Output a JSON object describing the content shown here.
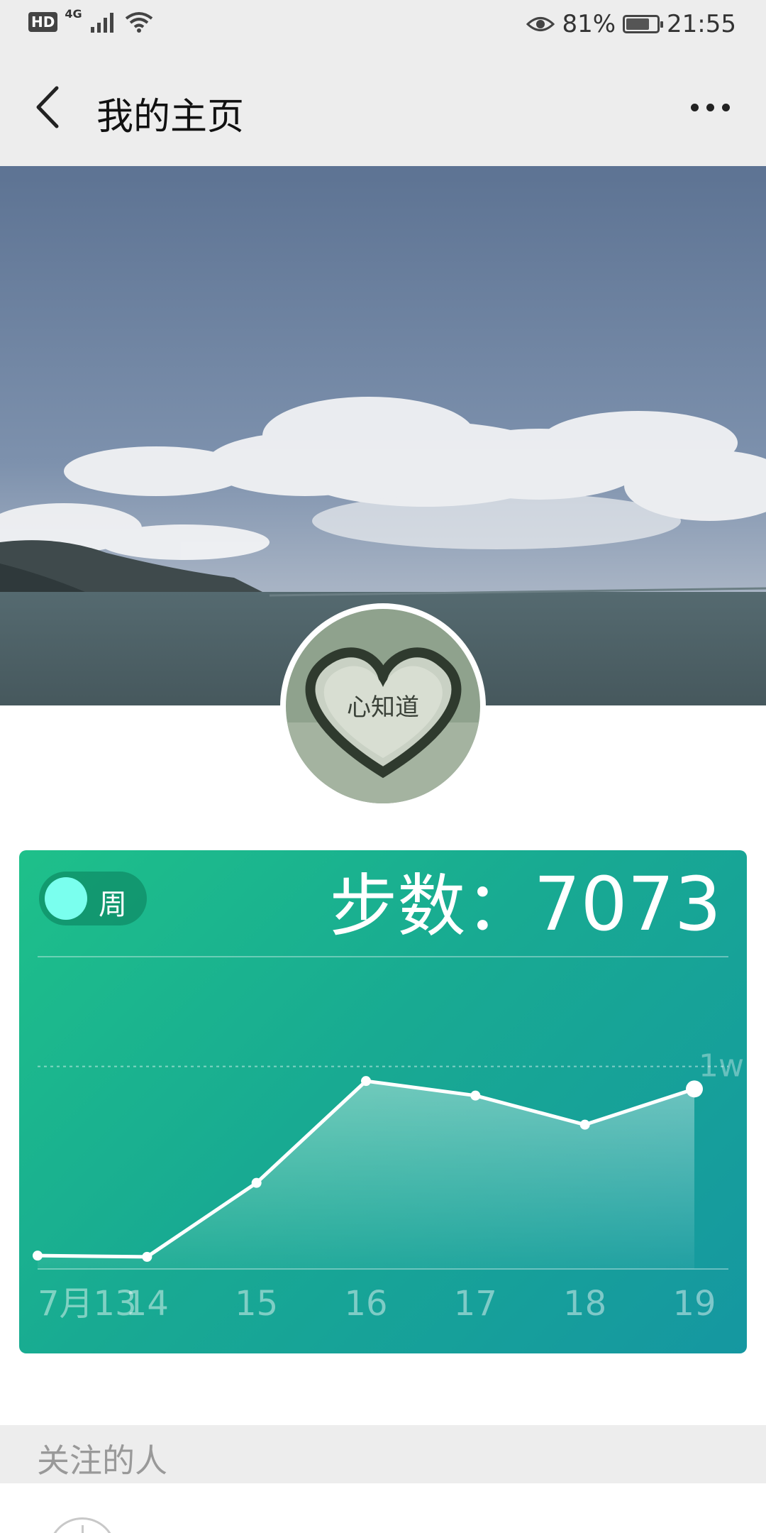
{
  "status_bar": {
    "hd": "HD",
    "network": "4G",
    "battery_percent": "81%",
    "battery_level": 0.81,
    "time": "21:55"
  },
  "nav": {
    "title": "我的主页",
    "back_icon": "chevron-left-icon",
    "more_icon": "more-horizontal-icon"
  },
  "profile": {
    "avatar_text": "心知道"
  },
  "steps_card": {
    "toggle_label": "周",
    "steps_label": "步数：",
    "steps_value": "7073",
    "colors": {
      "gradient_start": "#1ec08a",
      "gradient_end": "#1597a1",
      "toggle_knob": "#7affee"
    }
  },
  "chart_data": {
    "type": "line",
    "categories": [
      "7月13",
      "14",
      "15",
      "16",
      "17",
      "18",
      "19"
    ],
    "values": [
      200,
      150,
      3200,
      7400,
      6800,
      5600,
      7073
    ],
    "reference_line": {
      "value": 8000,
      "label": "1w"
    },
    "ylim": [
      0,
      12000
    ],
    "grid": false,
    "highlight_index": 6
  },
  "following": {
    "title": "关注的人"
  }
}
